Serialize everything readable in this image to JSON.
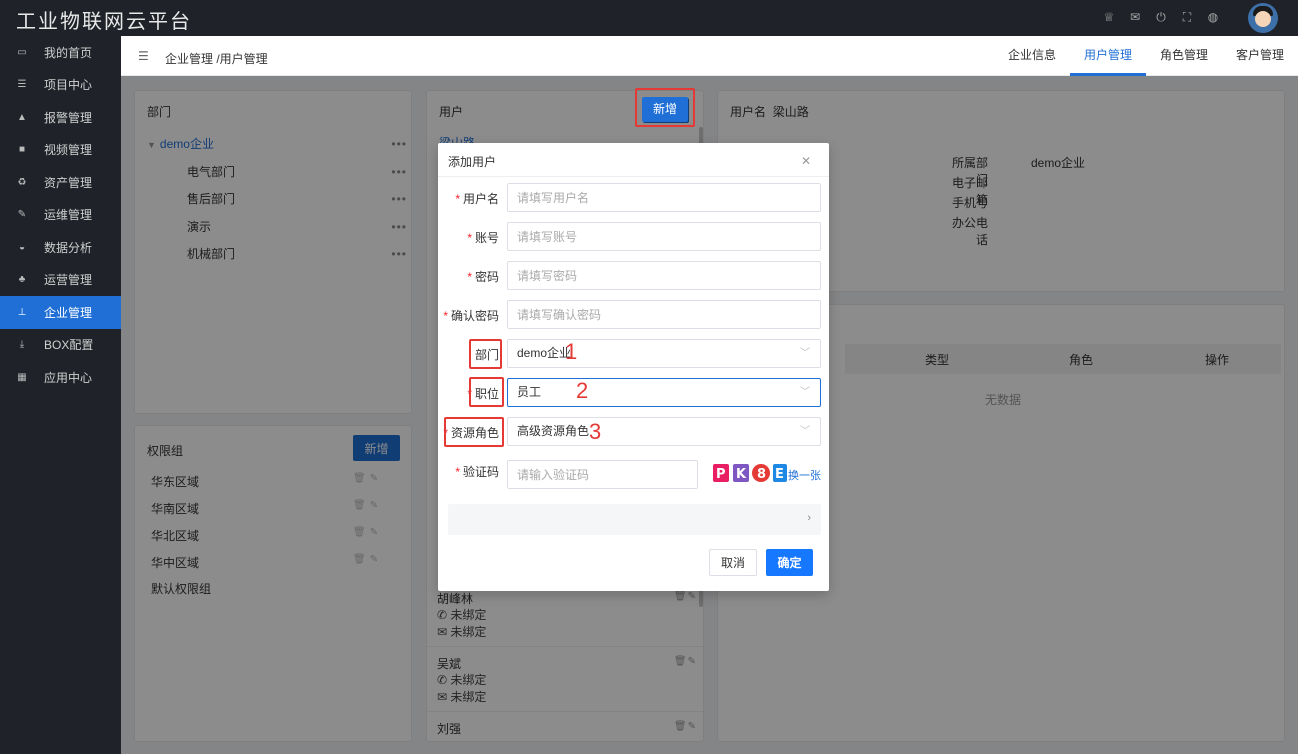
{
  "app": {
    "title": "工业物联网云平台"
  },
  "sidebar": {
    "items": [
      {
        "icon": "laptop-icon",
        "label": "我的首页"
      },
      {
        "icon": "list-icon",
        "label": "项目中心"
      },
      {
        "icon": "bell-icon",
        "label": "报警管理"
      },
      {
        "icon": "video-icon",
        "label": "视频管理"
      },
      {
        "icon": "recycle-icon",
        "label": "资产管理"
      },
      {
        "icon": "wrench-icon",
        "label": "运维管理"
      },
      {
        "icon": "chart-icon",
        "label": "数据分析"
      },
      {
        "icon": "users-icon",
        "label": "运营管理"
      },
      {
        "icon": "sitemap-icon",
        "label": "企业管理",
        "active": true
      },
      {
        "icon": "download-icon",
        "label": "BOX配置"
      },
      {
        "icon": "grid-icon",
        "label": "应用中心"
      }
    ]
  },
  "breadcrumb": {
    "text": "企业管理 /用户管理"
  },
  "tabs": [
    {
      "label": "企业信息"
    },
    {
      "label": "用户管理",
      "active": true
    },
    {
      "label": "角色管理"
    },
    {
      "label": "客户管理"
    }
  ],
  "dept_panel": {
    "title": "部门",
    "root": "demo企业",
    "children": [
      "电气部门",
      "售后部门",
      "演示",
      "机械部门"
    ]
  },
  "perm_panel": {
    "title": "权限组",
    "add_label": "新增",
    "items": [
      "华东区域",
      "华南区域",
      "华北区域",
      "华中区域",
      "默认权限组"
    ]
  },
  "user_panel": {
    "title": "用户",
    "add_label": "新增",
    "first_user": "梁山路",
    "visible_users": [
      {
        "name": "胡峰林",
        "phone": "未绑定",
        "email": "未绑定"
      },
      {
        "name": "吴斌",
        "phone": "未绑定",
        "email": "未绑定"
      },
      {
        "name": "刘强"
      }
    ]
  },
  "detail_panel": {
    "username_label": "用户名",
    "username": "梁山路",
    "fields": [
      {
        "label": "所属部门",
        "value": "demo企业"
      },
      {
        "label": "电子邮箱",
        "value": ""
      },
      {
        "label": "手机号",
        "value": ""
      },
      {
        "label": "办公电话",
        "value": ""
      }
    ],
    "table_headers": [
      "类型",
      "角色",
      "操作"
    ],
    "empty_text": "无数据"
  },
  "modal": {
    "title": "添加用户",
    "fields": {
      "username": {
        "label": "用户名",
        "placeholder": "请填写用户名"
      },
      "account": {
        "label": "账号",
        "placeholder": "请填写账号"
      },
      "password": {
        "label": "密码",
        "placeholder": "请填写密码"
      },
      "confirm_password": {
        "label": "确认密码",
        "placeholder": "请填写确认密码"
      },
      "department": {
        "label": "部门",
        "value": "demo企业"
      },
      "position": {
        "label": "职位",
        "value": "员工"
      },
      "resource_role": {
        "label": "资源角色",
        "value": "高级资源角色"
      },
      "captcha": {
        "label": "验证码",
        "placeholder": "请输入验证码",
        "image_text": "PK8E",
        "refresh_label": "换一张"
      }
    },
    "cancel_label": "取消",
    "confirm_label": "确定"
  },
  "annotations": [
    "1",
    "2",
    "3"
  ],
  "colors": {
    "primary": "#1f6fd6",
    "sidebar_bg": "#1f2329",
    "annotation_red": "#e53935"
  }
}
